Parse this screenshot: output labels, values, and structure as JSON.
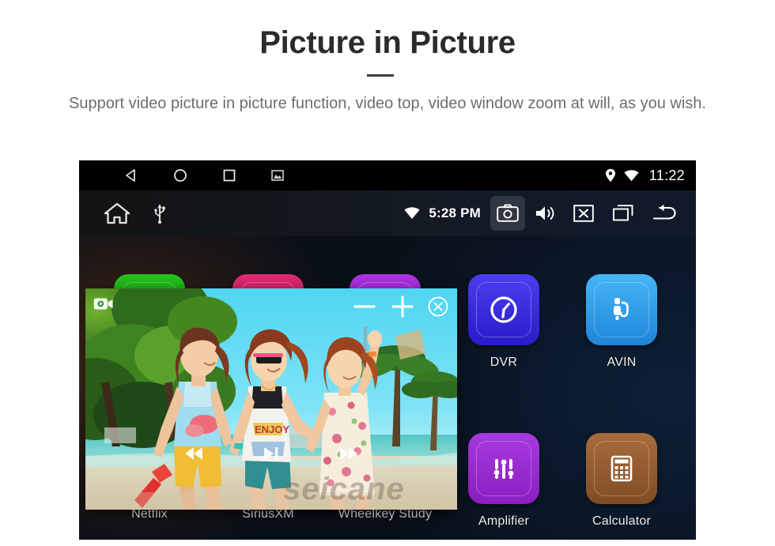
{
  "promo": {
    "title": "Picture in Picture",
    "subtitle": "Support video picture in picture function, video top, video window zoom at will, as you wish."
  },
  "device": {
    "statusbar": {
      "nav": [
        {
          "name": "back-nav-icon",
          "icon": "triangle-left"
        },
        {
          "name": "home-nav-icon",
          "icon": "circle"
        },
        {
          "name": "recents-nav-icon",
          "icon": "square"
        },
        {
          "name": "screenshot-nav-icon",
          "icon": "image"
        }
      ],
      "location_icon": "location-pin-icon",
      "wifi_icon": "wifi-icon",
      "clock": "11:22"
    },
    "toolbar": {
      "home_icon": "home-icon",
      "usb_icon": "usb-icon",
      "wifi_icon": "wifi-icon",
      "clock": "5:28 PM",
      "buttons": [
        {
          "name": "camera-button",
          "icon": "camera-icon",
          "active": true
        },
        {
          "name": "volume-button",
          "icon": "speaker-icon",
          "active": false
        },
        {
          "name": "close-app-button",
          "icon": "x-box-icon",
          "active": false
        },
        {
          "name": "recent-apps-button",
          "icon": "windows-icon",
          "active": false
        },
        {
          "name": "back-button",
          "icon": "back-arrow-icon",
          "active": false
        }
      ]
    },
    "apps": [
      {
        "name": "netflix",
        "label": "Netflix",
        "color": "#1db316",
        "color2": "#17a10f",
        "hidden_icon": true
      },
      {
        "name": "siriusxm",
        "label": "SiriusXM",
        "color": "#d6246a",
        "color2": "#c41b5c",
        "hidden_icon": true
      },
      {
        "name": "wheelkey-study",
        "label": "Wheelkey Study",
        "color": "#a32bd6",
        "color2": "#9021c4",
        "hidden_icon": true
      },
      {
        "name": "dvr",
        "label": "DVR",
        "color": "#3d33e0",
        "color2": "#2f22d2",
        "icon": "gauge-icon"
      },
      {
        "name": "avin",
        "label": "AVIN",
        "color": "#36a8f0",
        "color2": "#2490e0",
        "icon": "av-plug-icon"
      },
      {
        "name": "amplifier",
        "label": "Amplifier",
        "color": "#9b2fd6",
        "color2": "#8a24c4",
        "icon": "equalizer-icon"
      },
      {
        "name": "calculator",
        "label": "Calculator",
        "color": "#9a6236",
        "color2": "#854f27",
        "icon": "calculator-icon"
      }
    ],
    "pip": {
      "camera_icon": "video-camera-icon",
      "minimize_label": "−",
      "maximize_label": "+",
      "close_label": "close-circle-icon",
      "playback": [
        {
          "name": "previous-button",
          "icon": "previous-icon"
        },
        {
          "name": "play-pause-button",
          "icon": "play-pause-icon"
        },
        {
          "name": "next-button",
          "icon": "next-icon"
        }
      ],
      "watermark": "seicane"
    }
  }
}
